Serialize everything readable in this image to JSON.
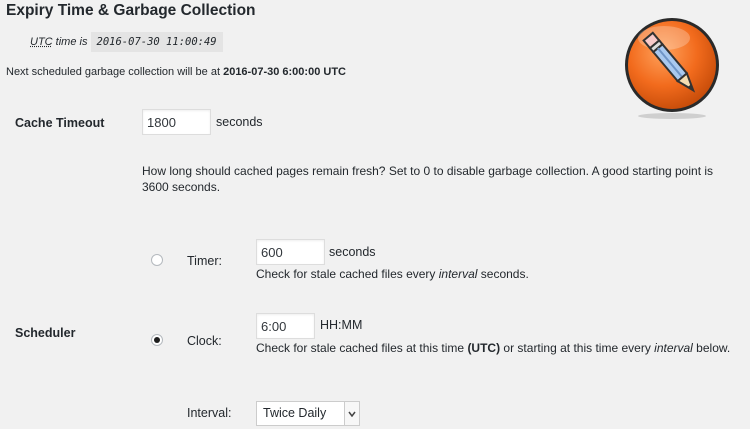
{
  "section": {
    "title": "Expiry Time & Garbage Collection",
    "utc_label_abbr": "UTC",
    "utc_label_rest": " time is ",
    "utc_time": "2016-07-30 11:00:49",
    "next_gc_prefix": "Next scheduled garbage collection will be at ",
    "next_gc_time": "2016-07-30 6:00:00 UTC"
  },
  "cache_timeout": {
    "label": "Cache Timeout",
    "value": "1800",
    "unit": "seconds",
    "description": "How long should cached pages remain fresh? Set to 0 to disable garbage collection. A good starting point is 3600 seconds."
  },
  "scheduler": {
    "label": "Scheduler",
    "timer": {
      "label": "Timer:",
      "checked": false,
      "value": "600",
      "unit": "seconds",
      "desc_prefix": "Check for stale cached files every ",
      "desc_em": "interval",
      "desc_suffix": " seconds."
    },
    "clock": {
      "label": "Clock:",
      "checked": true,
      "value": "6:00",
      "unit": "HH:MM",
      "desc_prefix": "Check for stale cached files at this time ",
      "desc_bold": "(UTC)",
      "desc_mid": " or starting at this time every ",
      "desc_em": "interval",
      "desc_suffix": " below."
    },
    "interval": {
      "label": "Interval:",
      "selected": "Twice Daily"
    }
  },
  "logo": {
    "icon": "pencil-icon",
    "color": "#f26b1d"
  }
}
